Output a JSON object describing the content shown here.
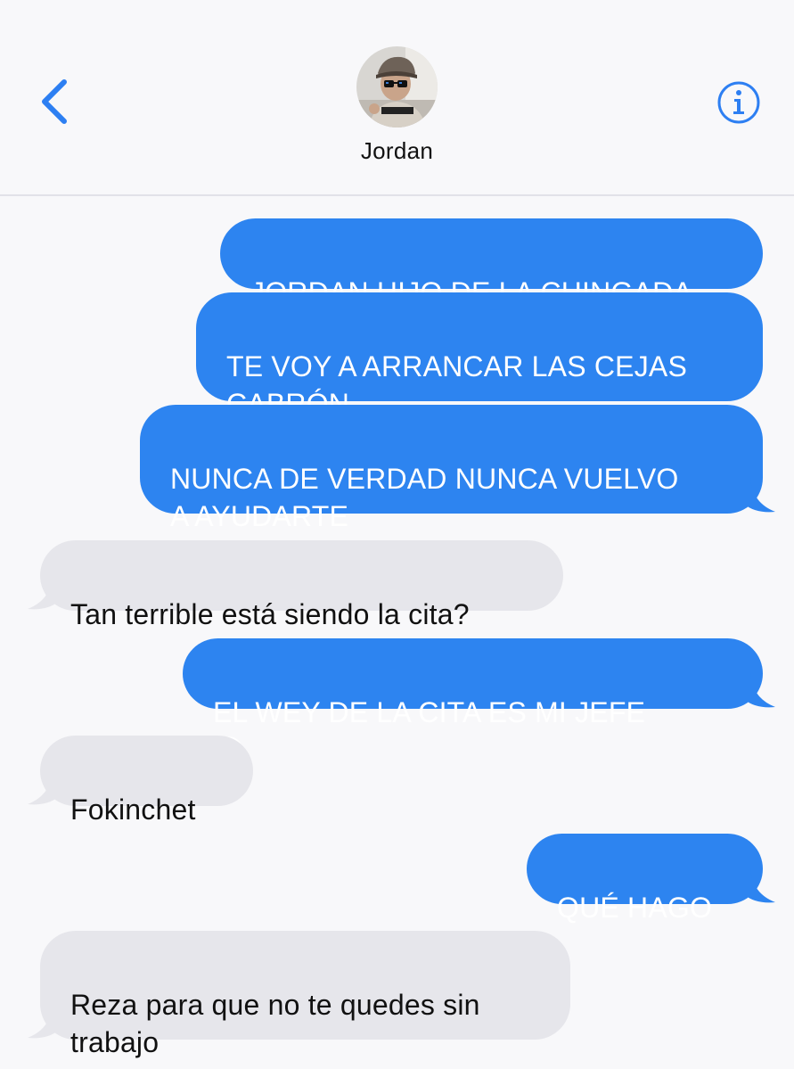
{
  "header": {
    "contact_name": "Jordan",
    "avatar_label": "avatar",
    "back_icon": "chevron-left-icon",
    "info_icon": "info-icon"
  },
  "colors": {
    "sent_bubble": "#2d84f0",
    "received_bubble": "#e6e6eb",
    "accent": "#2d7ff2"
  },
  "messages": [
    {
      "direction": "sent",
      "text": "JORDAN HIJO DE LA CHINGADA"
    },
    {
      "direction": "sent",
      "text": "TE VOY A ARRANCAR LAS CEJAS\nCABRÓN"
    },
    {
      "direction": "sent",
      "text": "NUNCA DE VERDAD NUNCA VUELVO\nA AYUDARTE"
    },
    {
      "direction": "received",
      "text": "Tan terrible está siendo la cita?"
    },
    {
      "direction": "sent",
      "text": "EL WEY DE LA CITA ES MI JEFE",
      "emoji": "😭"
    },
    {
      "direction": "received",
      "text": "Fokinchet"
    },
    {
      "direction": "sent",
      "text": "QUÉ HAGO"
    },
    {
      "direction": "received",
      "text": "Reza para que no te quedes sin\ntrabajo"
    }
  ]
}
